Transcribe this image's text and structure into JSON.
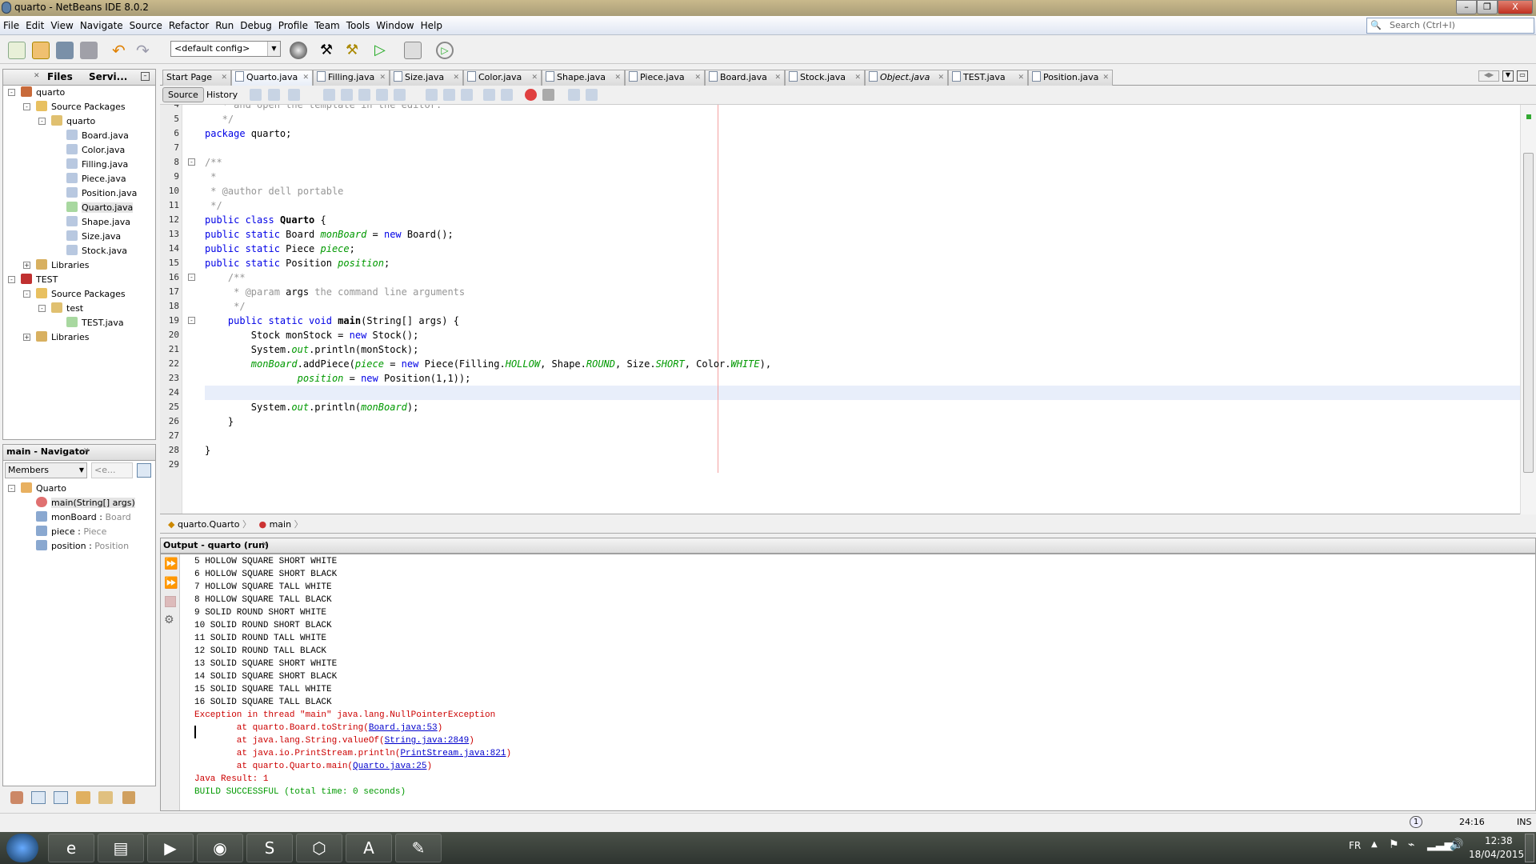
{
  "window": {
    "title": "quarto - NetBeans IDE 8.0.2",
    "controls": [
      "–",
      "❐",
      "X"
    ]
  },
  "menu": [
    "File",
    "Edit",
    "View",
    "Navigate",
    "Source",
    "Refactor",
    "Run",
    "Debug",
    "Profile",
    "Team",
    "Tools",
    "Window",
    "Help"
  ],
  "search": {
    "placeholder": "Search (Ctrl+I)"
  },
  "toolbar": {
    "config": "<default config>"
  },
  "projects": {
    "tabs": [
      "Files",
      "Servi..."
    ],
    "tree": [
      {
        "label": "quarto",
        "level": 0,
        "icon": "project-icon",
        "exp": "-"
      },
      {
        "label": "Source Packages",
        "level": 1,
        "icon": "source-packages-icon",
        "exp": "-"
      },
      {
        "label": "quarto",
        "level": 2,
        "icon": "package-icon",
        "exp": "-"
      },
      {
        "label": "Board.java",
        "level": 3,
        "icon": "java-file-icon"
      },
      {
        "label": "Color.java",
        "level": 3,
        "icon": "java-file-icon"
      },
      {
        "label": "Filling.java",
        "level": 3,
        "icon": "java-file-icon"
      },
      {
        "label": "Piece.java",
        "level": 3,
        "icon": "java-file-icon"
      },
      {
        "label": "Position.java",
        "level": 3,
        "icon": "java-file-icon"
      },
      {
        "label": "Quarto.java",
        "level": 3,
        "icon": "java-main-file-icon",
        "selected": true
      },
      {
        "label": "Shape.java",
        "level": 3,
        "icon": "java-file-icon"
      },
      {
        "label": "Size.java",
        "level": 3,
        "icon": "java-file-icon"
      },
      {
        "label": "Stock.java",
        "level": 3,
        "icon": "java-file-icon"
      },
      {
        "label": "Libraries",
        "level": 1,
        "icon": "libraries-icon",
        "exp": "+"
      },
      {
        "label": "TEST",
        "level": 0,
        "icon": "project-error-icon",
        "exp": "-"
      },
      {
        "label": "Source Packages",
        "level": 1,
        "icon": "source-packages-icon",
        "exp": "-"
      },
      {
        "label": "test",
        "level": 2,
        "icon": "package-icon",
        "exp": "-"
      },
      {
        "label": "TEST.java",
        "level": 3,
        "icon": "java-main-file-icon"
      },
      {
        "label": "Libraries",
        "level": 1,
        "icon": "libraries-icon",
        "exp": "+"
      }
    ]
  },
  "navigator": {
    "title": "main - Navigator",
    "filter": "Members",
    "filter2": "<e...",
    "items": [
      {
        "label": "Quarto",
        "type": "",
        "level": 0,
        "icon": "class-icon"
      },
      {
        "label": "main(String[] args)",
        "type": "",
        "level": 1,
        "icon": "method-icon",
        "selected": true
      },
      {
        "label": "monBoard : ",
        "type": "Board",
        "level": 1,
        "icon": "field-icon"
      },
      {
        "label": "piece : ",
        "type": "Piece",
        "level": 1,
        "icon": "field-icon"
      },
      {
        "label": "position : ",
        "type": "Position",
        "level": 1,
        "icon": "field-icon"
      }
    ]
  },
  "editor": {
    "tabs": [
      {
        "label": "Start Page"
      },
      {
        "label": "Quarto.java",
        "active": true
      },
      {
        "label": "Filling.java"
      },
      {
        "label": "Size.java"
      },
      {
        "label": "Color.java"
      },
      {
        "label": "Shape.java"
      },
      {
        "label": "Piece.java"
      },
      {
        "label": "Board.java"
      },
      {
        "label": "Stock.java"
      },
      {
        "label": "Object.java",
        "italic": true
      },
      {
        "label": "TEST.java"
      },
      {
        "label": "Position.java"
      }
    ],
    "source_label": "Source",
    "history_label": "History",
    "current_line": 24,
    "lines": [
      {
        "n": 4,
        "t": [
          [
            "   * and open the template in the editor.",
            "cmt"
          ]
        ]
      },
      {
        "n": 5,
        "t": [
          [
            "   */",
            "cmt"
          ]
        ]
      },
      {
        "n": 6,
        "t": [
          [
            "package",
            "kw"
          ],
          [
            " quarto;",
            ""
          ]
        ]
      },
      {
        "n": 7,
        "t": []
      },
      {
        "n": 8,
        "t": [
          [
            "/**",
            "cmt"
          ]
        ]
      },
      {
        "n": 9,
        "t": [
          [
            " *",
            "cmt"
          ]
        ]
      },
      {
        "n": 10,
        "t": [
          [
            " * @author dell portable",
            "cmt"
          ]
        ]
      },
      {
        "n": 11,
        "t": [
          [
            " */",
            "cmt"
          ]
        ]
      },
      {
        "n": 12,
        "t": [
          [
            "public class",
            "kw"
          ],
          [
            " ",
            ""
          ],
          [
            "Quarto",
            "bold"
          ],
          [
            " {",
            ""
          ]
        ]
      },
      {
        "n": 13,
        "t": [
          [
            "public static",
            "kw"
          ],
          [
            " Board ",
            ""
          ],
          [
            "monBoard",
            "fld"
          ],
          [
            " = ",
            ""
          ],
          [
            "new",
            "kw"
          ],
          [
            " Board();",
            ""
          ]
        ]
      },
      {
        "n": 14,
        "t": [
          [
            "public static",
            "kw"
          ],
          [
            " Piece ",
            ""
          ],
          [
            "piece",
            "fld"
          ],
          [
            ";",
            ""
          ]
        ]
      },
      {
        "n": 15,
        "t": [
          [
            "public static",
            "kw"
          ],
          [
            " Position ",
            ""
          ],
          [
            "position",
            "fld"
          ],
          [
            ";",
            ""
          ]
        ]
      },
      {
        "n": 16,
        "t": [
          [
            "    /**",
            "cmt"
          ]
        ]
      },
      {
        "n": 17,
        "t": [
          [
            "     * @param ",
            "cmt"
          ],
          [
            "args",
            ""
          ],
          [
            " the command line arguments",
            "cmt"
          ]
        ]
      },
      {
        "n": 18,
        "t": [
          [
            "     */",
            "cmt"
          ]
        ]
      },
      {
        "n": 19,
        "t": [
          [
            "    public static void",
            "kw"
          ],
          [
            " ",
            ""
          ],
          [
            "main",
            "bold"
          ],
          [
            "(String[] args) {",
            ""
          ]
        ]
      },
      {
        "n": 20,
        "t": [
          [
            "        Stock monStock = ",
            ""
          ],
          [
            "new",
            "kw"
          ],
          [
            " Stock();",
            ""
          ]
        ]
      },
      {
        "n": 21,
        "t": [
          [
            "        System.",
            ""
          ],
          [
            "out",
            "fld"
          ],
          [
            ".println(monStock);",
            ""
          ]
        ]
      },
      {
        "n": 22,
        "t": [
          [
            "        ",
            ""
          ],
          [
            "monBoard",
            "fld"
          ],
          [
            ".addPiece(",
            ""
          ],
          [
            "piece",
            "fld"
          ],
          [
            " = ",
            ""
          ],
          [
            "new",
            "kw"
          ],
          [
            " Piece(Filling.",
            ""
          ],
          [
            "HOLLOW",
            "fld"
          ],
          [
            ", Shape.",
            ""
          ],
          [
            "ROUND",
            "fld"
          ],
          [
            ", Size.",
            ""
          ],
          [
            "SHORT",
            "fld"
          ],
          [
            ", Color.",
            ""
          ],
          [
            "WHITE",
            "fld"
          ],
          [
            "),",
            ""
          ]
        ]
      },
      {
        "n": 23,
        "t": [
          [
            "                ",
            ""
          ],
          [
            "position",
            "fld"
          ],
          [
            " = ",
            ""
          ],
          [
            "new",
            "kw"
          ],
          [
            " Position(1,1));",
            ""
          ]
        ]
      },
      {
        "n": 24,
        "t": []
      },
      {
        "n": 25,
        "t": [
          [
            "        System.",
            ""
          ],
          [
            "out",
            "fld"
          ],
          [
            ".println(",
            ""
          ],
          [
            "monBoard",
            "fld"
          ],
          [
            ");",
            ""
          ]
        ]
      },
      {
        "n": 26,
        "t": [
          [
            "    }",
            ""
          ]
        ]
      },
      {
        "n": 27,
        "t": []
      },
      {
        "n": 28,
        "t": [
          [
            "}",
            ""
          ]
        ]
      },
      {
        "n": 29,
        "t": []
      }
    ],
    "breadcrumb": [
      "quarto.Quarto",
      "main"
    ]
  },
  "output": {
    "title": "Output - quarto (run)",
    "lines": [
      [
        [
          "5 HOLLOW SQUARE SHORT WHITE",
          ""
        ]
      ],
      [
        [
          "6 HOLLOW SQUARE SHORT BLACK",
          ""
        ]
      ],
      [
        [
          "7 HOLLOW SQUARE TALL WHITE",
          ""
        ]
      ],
      [
        [
          "8 HOLLOW SQUARE TALL BLACK",
          ""
        ]
      ],
      [
        [
          "9 SOLID ROUND SHORT WHITE",
          ""
        ]
      ],
      [
        [
          "10 SOLID ROUND SHORT BLACK",
          ""
        ]
      ],
      [
        [
          "11 SOLID ROUND TALL WHITE",
          ""
        ]
      ],
      [
        [
          "12 SOLID ROUND TALL BLACK",
          ""
        ]
      ],
      [
        [
          "13 SOLID SQUARE SHORT WHITE",
          ""
        ]
      ],
      [
        [
          "14 SOLID SQUARE SHORT BLACK",
          ""
        ]
      ],
      [
        [
          "15 SOLID SQUARE TALL WHITE",
          ""
        ]
      ],
      [
        [
          "16 SOLID SQUARE TALL BLACK",
          ""
        ]
      ],
      [
        [
          "Exception in thread \"main\" java.lang.NullPointerException",
          "o-err"
        ]
      ],
      [
        [
          "        at quarto.Board.toString(",
          "o-err"
        ],
        [
          "Board.java:53",
          "o-link"
        ],
        [
          ")",
          "o-err"
        ]
      ],
      [
        [
          "        at java.lang.String.valueOf(",
          "o-err"
        ],
        [
          "String.java:2849",
          "o-link"
        ],
        [
          ")",
          "o-err"
        ]
      ],
      [
        [
          "        at java.io.PrintStream.println(",
          "o-err"
        ],
        [
          "PrintStream.java:821",
          "o-link"
        ],
        [
          ")",
          "o-err"
        ]
      ],
      [
        [
          "        at quarto.Quarto.main(",
          "o-err"
        ],
        [
          "Quarto.java:25",
          "o-link"
        ],
        [
          ")",
          "o-err"
        ]
      ],
      [
        [
          "Java Result: 1",
          "o-err"
        ]
      ],
      [
        [
          "BUILD SUCCESSFUL (total time: 0 seconds)",
          "o-ok"
        ]
      ]
    ]
  },
  "status": {
    "notifications": "1",
    "position": "24:16",
    "mode": "INS"
  },
  "taskbar": {
    "apps": [
      "internet-explorer",
      "file-explorer",
      "media-player",
      "chrome",
      "skype",
      "virtualbox",
      "acrobat",
      "paint"
    ],
    "lang": "FR",
    "time": "12:38",
    "date": "18/04/2015"
  }
}
